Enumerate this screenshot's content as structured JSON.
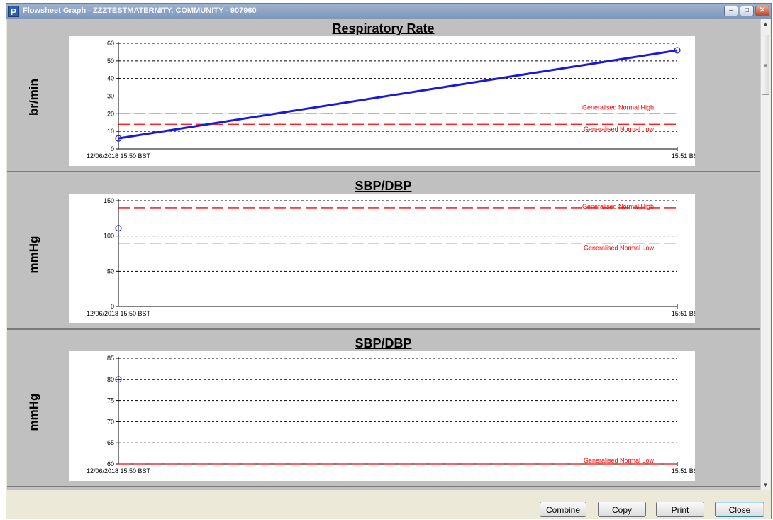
{
  "window": {
    "title": "Flowsheet Graph - ZZZTESTMATERNITY, COMMUNITY  - 907960",
    "app_icon_letter": "P"
  },
  "colors": {
    "series_blue": "#1a1adb",
    "reference_red": "#ff0000",
    "panel_bg": "#c0c0c0",
    "plot_bg": "#ffffff"
  },
  "panels": [
    {
      "title": "Respiratory Rate",
      "unit": "br/min"
    },
    {
      "title": "SBP/DBP",
      "unit": "mmHg"
    },
    {
      "title": "SBP/DBP",
      "unit": "mmHg"
    }
  ],
  "chart_data": [
    {
      "type": "line",
      "title": "Respiratory Rate",
      "ylabel": "br/min",
      "x": [
        "12/06/2018 15:50 BST",
        "15:51 BST"
      ],
      "ylim": [
        0,
        60
      ],
      "yticks": [
        0,
        10,
        20,
        30,
        40,
        50,
        60
      ],
      "grid": true,
      "series": [
        {
          "values": [
            6,
            56
          ]
        }
      ],
      "reference_lines": [
        {
          "name": "Generalised Normal High",
          "value": 20
        },
        {
          "name": "Generalised Normal Low",
          "value": 14
        }
      ]
    },
    {
      "type": "scatter",
      "title": "SBP/DBP",
      "ylabel": "mmHg",
      "x": [
        "12/06/2018 15:50 BST",
        "15:51 BST"
      ],
      "ylim": [
        0,
        150
      ],
      "yticks": [
        0,
        50,
        100,
        150
      ],
      "grid": true,
      "series": [
        {
          "values": [
            111,
            null
          ]
        }
      ],
      "reference_lines": [
        {
          "name": "Generalised Normal High",
          "value": 140
        },
        {
          "name": "Generalised Normal Low",
          "value": 90
        }
      ]
    },
    {
      "type": "scatter",
      "title": "SBP/DBP",
      "ylabel": "mmHg",
      "x": [
        "12/06/2018 15:50 BST",
        "15:51 BST"
      ],
      "ylim": [
        60,
        85
      ],
      "yticks": [
        60,
        65,
        70,
        75,
        80,
        85
      ],
      "grid": true,
      "series": [
        {
          "values": [
            80,
            null
          ]
        }
      ],
      "reference_lines": [
        {
          "name": "Generalised Normal Low",
          "value": 60
        }
      ]
    }
  ],
  "buttons": {
    "combine": "Combine",
    "copy": "Copy",
    "print": "Print",
    "close": "Close"
  },
  "titlebar_buttons": {
    "minimize": "–",
    "maximize": "□",
    "close": "✕"
  },
  "scrollbar": {
    "up_arrow": "▲",
    "down_arrow": "▼"
  }
}
